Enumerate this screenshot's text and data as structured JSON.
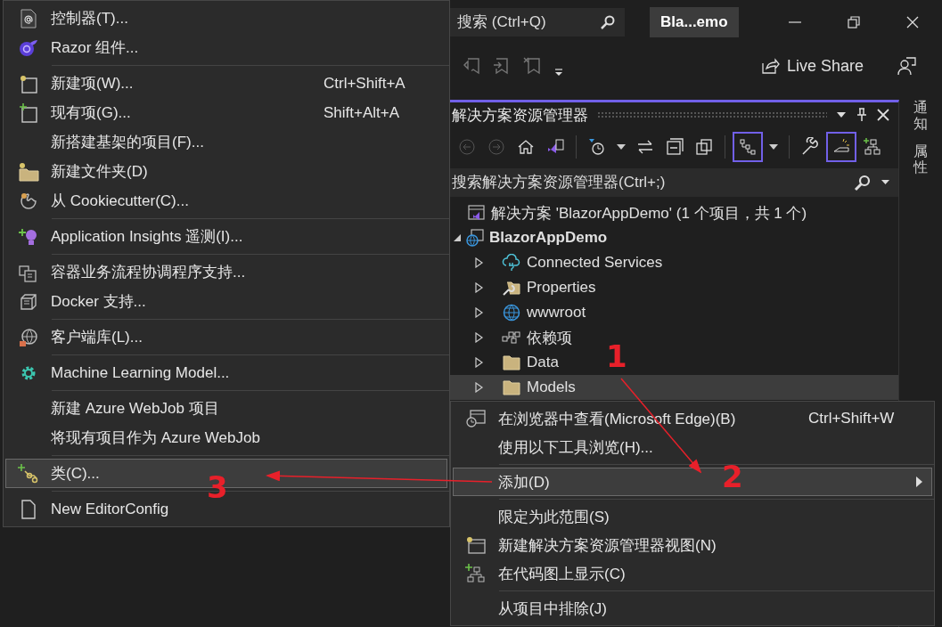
{
  "title_bar": {
    "search": {
      "placeholder": "搜索 (Ctrl+Q)"
    },
    "title": "Bla...emo"
  },
  "toolbar": {
    "live_share": "Live Share"
  },
  "solution_explorer": {
    "title": "解决方案资源管理器",
    "toolbar": [
      {
        "disabled": true,
        "selected": false
      },
      {
        "disabled": true,
        "selected": false
      },
      {
        "disabled": false,
        "selected": false
      },
      {
        "disabled": false,
        "selected": false
      },
      {
        "disabled": false,
        "selected": false
      },
      {
        "disabled": false,
        "selected": false
      },
      {
        "disabled": false,
        "selected": false
      },
      {
        "disabled": false,
        "selected": false
      },
      {
        "disabled": false,
        "selected": true
      },
      {
        "disabled": false,
        "selected": false
      },
      {
        "disabled": false,
        "selected": true
      },
      {
        "disabled": false,
        "selected": false
      }
    ],
    "search": {
      "placeholder": "搜索解决方案资源管理器(Ctrl+;)"
    },
    "tree": [
      {
        "label": "解决方案 'BlazorAppDemo' (1 个项目，共 1 个)",
        "selected": false,
        "children": [
          {
            "label": "BlazorAppDemo",
            "expanded": true,
            "selected": false,
            "children": [
              {
                "label": "Connected Services",
                "expanded": false,
                "selected": false
              },
              {
                "label": "Properties",
                "expanded": false,
                "selected": false
              },
              {
                "label": "wwwroot",
                "expanded": false,
                "selected": false
              },
              {
                "label": "依赖项",
                "expanded": false,
                "selected": false
              },
              {
                "label": "Data",
                "expanded": false,
                "selected": false
              },
              {
                "label": "Models",
                "expanded": false,
                "selected": true
              }
            ]
          }
        ]
      }
    ]
  },
  "side_tabs": [
    {
      "label": "通知"
    },
    {
      "label": "属性"
    }
  ],
  "add_submenu": {
    "sections": [
      {
        "items": [
          {
            "label": "控制器(T)...",
            "selected": false
          },
          {
            "label": "Razor 组件...",
            "selected": false
          }
        ]
      },
      {
        "items": [
          {
            "label": "新建项(W)...",
            "shortcut": "Ctrl+Shift+A",
            "selected": false
          },
          {
            "label": "现有项(G)...",
            "shortcut": "Shift+Alt+A",
            "selected": false
          },
          {
            "label": "新搭建基架的项目(F)...",
            "selected": false
          },
          {
            "label": "新建文件夹(D)",
            "selected": false
          },
          {
            "label": "从 Cookiecutter(C)...",
            "selected": false
          }
        ]
      },
      {
        "items": [
          {
            "label": "Application Insights 遥测(I)...",
            "selected": false
          }
        ]
      },
      {
        "items": [
          {
            "label": "容器业务流程协调程序支持...",
            "selected": false
          },
          {
            "label": "Docker 支持...",
            "selected": false
          }
        ]
      },
      {
        "items": [
          {
            "label": "客户端库(L)...",
            "selected": false
          }
        ]
      },
      {
        "items": [
          {
            "label": "Machine Learning Model...",
            "selected": false
          }
        ]
      },
      {
        "items": [
          {
            "label": "新建 Azure WebJob 项目",
            "selected": false
          },
          {
            "label": "将现有项目作为 Azure WebJob",
            "selected": false
          }
        ]
      },
      {
        "items": [
          {
            "label": "类(C)...",
            "selected": true
          }
        ]
      },
      {
        "items": [
          {
            "label": "New EditorConfig",
            "selected": false
          }
        ]
      }
    ]
  },
  "context_menu": {
    "sections": [
      {
        "items": [
          {
            "label": "在浏览器中查看(Microsoft Edge)(B)",
            "shortcut": "Ctrl+Shift+W",
            "selected": false,
            "submenu": false
          },
          {
            "label": "使用以下工具浏览(H)...",
            "selected": false,
            "submenu": false
          }
        ]
      },
      {
        "items": [
          {
            "label": "添加(D)",
            "selected": true,
            "submenu": true
          }
        ]
      },
      {
        "items": [
          {
            "label": "限定为此范围(S)",
            "selected": false,
            "submenu": false
          },
          {
            "label": "新建解决方案资源管理器视图(N)",
            "selected": false,
            "submenu": false
          },
          {
            "label": "在代码图上显示(C)",
            "selected": false,
            "submenu": false
          }
        ]
      },
      {
        "items": [
          {
            "label": "从项目中排除(J)",
            "selected": false,
            "submenu": false
          }
        ]
      }
    ]
  },
  "annotations": [
    {
      "label": "1"
    },
    {
      "label": "2"
    },
    {
      "label": "3"
    }
  ]
}
